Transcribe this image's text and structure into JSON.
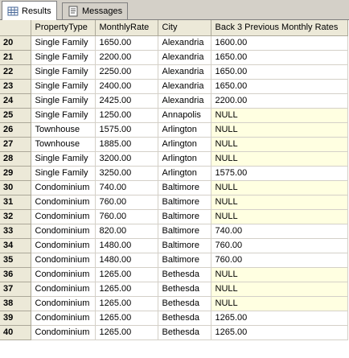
{
  "tabs": [
    {
      "label": "Results",
      "icon": "results-grid-icon",
      "active": true
    },
    {
      "label": "Messages",
      "icon": "messages-icon",
      "active": false
    }
  ],
  "grid": {
    "columns": [
      "PropertyType",
      "MonthlyRate",
      "City",
      "Back 3 Previous Monthly Rates"
    ],
    "rows": [
      {
        "n": "20",
        "type": "Single Family",
        "rate": "1650.00",
        "city": "Alexandria",
        "back3": "1600.00"
      },
      {
        "n": "21",
        "type": "Single Family",
        "rate": "2200.00",
        "city": "Alexandria",
        "back3": "1650.00"
      },
      {
        "n": "22",
        "type": "Single Family",
        "rate": "2250.00",
        "city": "Alexandria",
        "back3": "1650.00"
      },
      {
        "n": "23",
        "type": "Single Family",
        "rate": "2400.00",
        "city": "Alexandria",
        "back3": "1650.00"
      },
      {
        "n": "24",
        "type": "Single Family",
        "rate": "2425.00",
        "city": "Alexandria",
        "back3": "2200.00"
      },
      {
        "n": "25",
        "type": "Single Family",
        "rate": "1250.00",
        "city": "Annapolis",
        "back3": "NULL"
      },
      {
        "n": "26",
        "type": "Townhouse",
        "rate": "1575.00",
        "city": "Arlington",
        "back3": "NULL"
      },
      {
        "n": "27",
        "type": "Townhouse",
        "rate": "1885.00",
        "city": "Arlington",
        "back3": "NULL"
      },
      {
        "n": "28",
        "type": "Single Family",
        "rate": "3200.00",
        "city": "Arlington",
        "back3": "NULL"
      },
      {
        "n": "29",
        "type": "Single Family",
        "rate": "3250.00",
        "city": "Arlington",
        "back3": "1575.00"
      },
      {
        "n": "30",
        "type": "Condominium",
        "rate": "740.00",
        "city": "Baltimore",
        "back3": "NULL"
      },
      {
        "n": "31",
        "type": "Condominium",
        "rate": "760.00",
        "city": "Baltimore",
        "back3": "NULL"
      },
      {
        "n": "32",
        "type": "Condominium",
        "rate": "760.00",
        "city": "Baltimore",
        "back3": "NULL"
      },
      {
        "n": "33",
        "type": "Condominium",
        "rate": "820.00",
        "city": "Baltimore",
        "back3": "740.00"
      },
      {
        "n": "34",
        "type": "Condominium",
        "rate": "1480.00",
        "city": "Baltimore",
        "back3": "760.00"
      },
      {
        "n": "35",
        "type": "Condominium",
        "rate": "1480.00",
        "city": "Baltimore",
        "back3": "760.00"
      },
      {
        "n": "36",
        "type": "Condominium",
        "rate": "1265.00",
        "city": "Bethesda",
        "back3": "NULL"
      },
      {
        "n": "37",
        "type": "Condominium",
        "rate": "1265.00",
        "city": "Bethesda",
        "back3": "NULL"
      },
      {
        "n": "38",
        "type": "Condominium",
        "rate": "1265.00",
        "city": "Bethesda",
        "back3": "NULL"
      },
      {
        "n": "39",
        "type": "Condominium",
        "rate": "1265.00",
        "city": "Bethesda",
        "back3": "1265.00"
      },
      {
        "n": "40",
        "type": "Condominium",
        "rate": "1265.00",
        "city": "Bethesda",
        "back3": "1265.00"
      }
    ]
  },
  "colors": {
    "header_bg": "#ece9d8",
    "null_bg": "#ffffe1",
    "gridline": "#d4d0c8"
  }
}
